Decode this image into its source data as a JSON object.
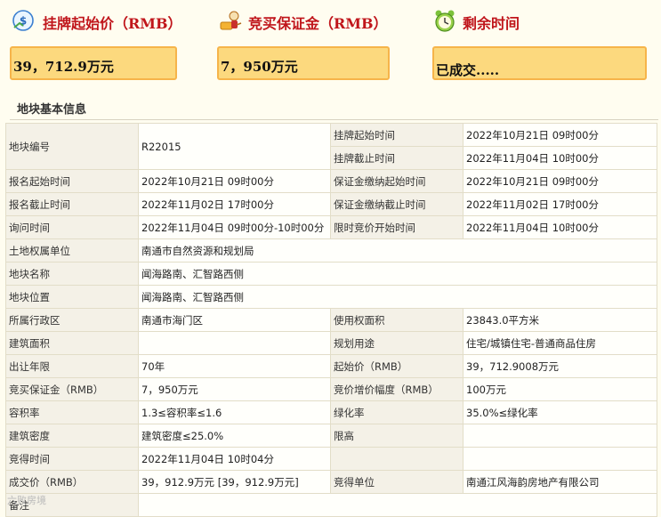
{
  "header": {
    "start_price_label": "挂牌起始价（RMB）",
    "deposit_label": "竞买保证金（RMB）",
    "remaining_label": "剩余时间",
    "start_price_value": "39，712.9万元",
    "deposit_value": "7，950万元",
    "remaining_value": "已成交....."
  },
  "section_title": "地块基本信息",
  "rows": {
    "r1": {
      "k1": "地块编号",
      "v1": "R22015",
      "k2": "挂牌起始时间",
      "v2": "2022年10月21日 09时00分"
    },
    "r2": {
      "k2": "挂牌截止时间",
      "v2": "2022年11月04日 10时00分"
    },
    "r3": {
      "k1": "报名起始时间",
      "v1": "2022年10月21日 09时00分",
      "k2": "保证金缴纳起始时间",
      "v2": "2022年10月21日 09时00分"
    },
    "r4": {
      "k1": "报名截止时间",
      "v1": "2022年11月02日 17时00分",
      "k2": "保证金缴纳截止时间",
      "v2": "2022年11月02日 17时00分"
    },
    "r5": {
      "k1": "询问时间",
      "v1": "2022年11月04日 09时00分-10时00分",
      "k2": "限时竞价开始时间",
      "v2": "2022年11月04日 10时00分"
    },
    "r6": {
      "k1": "土地权属单位",
      "v1": "南通市自然资源和规划局"
    },
    "r7": {
      "k1": "地块名称",
      "v1": "闻海路南、汇智路西侧"
    },
    "r8": {
      "k1": "地块位置",
      "v1": "闻海路南、汇智路西侧"
    },
    "r9": {
      "k1": "所属行政区",
      "v1": "南通市海门区",
      "k2": "使用权面积",
      "v2": "23843.0平方米"
    },
    "r10": {
      "k1": "建筑面积",
      "v1": "",
      "k2": "规划用途",
      "v2": "住宅/城镇住宅-普通商品住房"
    },
    "r11": {
      "k1": "出让年限",
      "v1": "70年",
      "k2": "起始价（RMB）",
      "v2": "39，712.9008万元"
    },
    "r12": {
      "k1": "竞买保证金（RMB）",
      "v1": "7，950万元",
      "k2": "竞价增价幅度（RMB）",
      "v2": "100万元"
    },
    "r13": {
      "k1": "容积率",
      "v1": "1.3≤容积率≤1.6",
      "k2": "绿化率",
      "v2": "35.0%≤绿化率"
    },
    "r14": {
      "k1": "建筑密度",
      "v1": "建筑密度≤25.0%",
      "k2": "限高",
      "v2": ""
    },
    "r15": {
      "k1": "竞得时间",
      "v1": "2022年11月04日 10时04分",
      "k2": "",
      "v2": ""
    },
    "r16": {
      "k1": "成交价（RMB）",
      "v1": "39，912.9万元 [39，912.9万元]",
      "k2": "竞得单位",
      "v2": "南通江风海韵房地产有限公司"
    },
    "r17": {
      "k1": "备注"
    }
  },
  "watermark": "六败房境",
  "icons": {
    "start_price": "price-tag-icon",
    "deposit": "auction-deposit-icon",
    "remaining": "alarm-clock-icon"
  }
}
